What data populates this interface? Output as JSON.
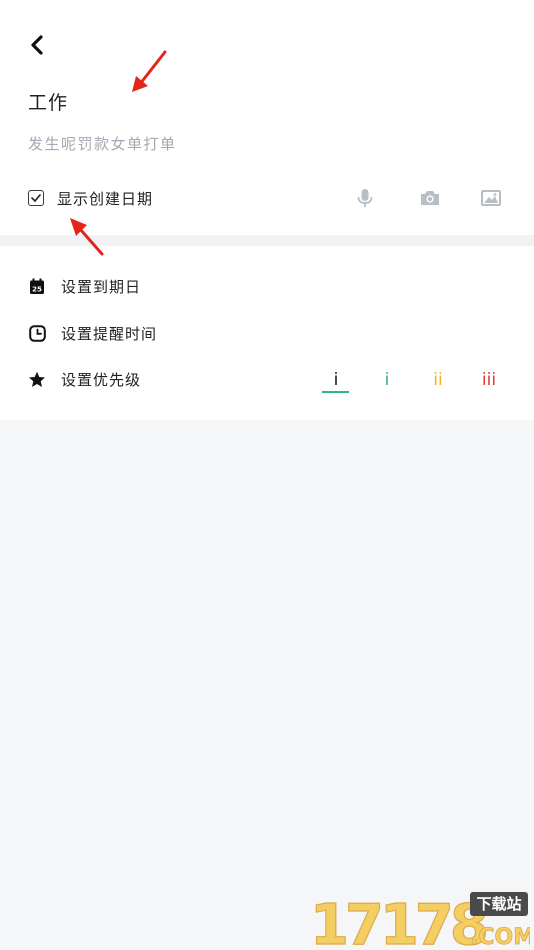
{
  "header": {
    "title": "工作",
    "subtitle": "发生呢罚款女单打单"
  },
  "options": {
    "show_date_label": "显示创建日期",
    "show_date_checked": true
  },
  "media_icons": [
    "microphone-icon",
    "camera-icon",
    "image-icon"
  ],
  "settings": {
    "due_date_label": "设置到期日",
    "calendar_day": "25",
    "reminder_label": "设置提醒时间",
    "priority_label": "设置优先级"
  },
  "priority": {
    "levels": [
      {
        "label": "i",
        "color": "#111111",
        "selected": true
      },
      {
        "label": "i",
        "color": "#2fb87c",
        "selected": false
      },
      {
        "label": "ii",
        "color": "#f5b31d",
        "selected": false
      },
      {
        "label": "iii",
        "color": "#e53935",
        "selected": false
      }
    ],
    "selected_underline_color": "#2fb87c"
  },
  "watermark": {
    "number": "17178",
    "badge": "下载站",
    "suffix": ".COM"
  }
}
